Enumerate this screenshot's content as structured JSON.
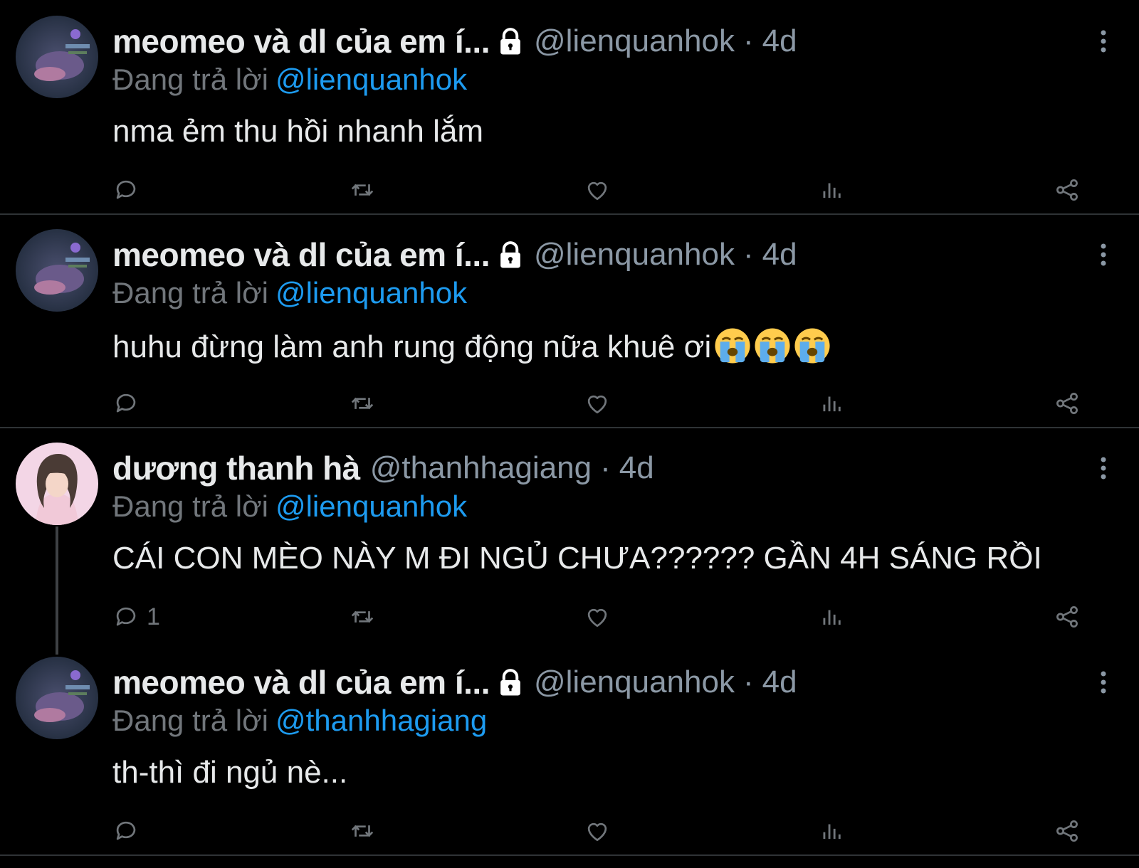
{
  "tweets": [
    {
      "name": "meomeo và dl của em í...",
      "locked": true,
      "handle": "@lienquanhok",
      "time": "4d",
      "reply_prefix": "Đang trả lời",
      "reply_to": "@lienquanhok",
      "text": "nma ẻm thu hồi nhanh lắm",
      "reply_count": ""
    },
    {
      "name": "meomeo và dl của em í...",
      "locked": true,
      "handle": "@lienquanhok",
      "time": "4d",
      "reply_prefix": "Đang trả lời",
      "reply_to": "@lienquanhok",
      "text": "huhu đừng làm anh rung động nữa khuê ơi",
      "emojis": [
        "loudly-crying-face",
        "loudly-crying-face",
        "loudly-crying-face"
      ],
      "reply_count": ""
    },
    {
      "name": "dương thanh hà",
      "locked": false,
      "handle": "@thanhhagiang",
      "time": "4d",
      "reply_prefix": "Đang trả lời",
      "reply_to": "@lienquanhok",
      "text": "CÁI CON MÈO NÀY M ĐI NGỦ CHƯA?????? GẦN 4H SÁNG RỒI",
      "reply_count": "1"
    },
    {
      "name": "meomeo và dl của em í...",
      "locked": true,
      "handle": "@lienquanhok",
      "time": "4d",
      "reply_prefix": "Đang trả lời",
      "reply_to": "@thanhhagiang",
      "text": "th-thì đi ngủ nè...",
      "reply_count": ""
    }
  ],
  "icons": {
    "reply": "reply-icon",
    "retweet": "retweet-icon",
    "like": "heart-icon",
    "views": "views-icon",
    "share": "share-icon",
    "more": "more-vertical-icon",
    "lock": "lock-icon"
  },
  "colors": {
    "background": "#000000",
    "name": "#e7e9ea",
    "handle": "#8b98a5",
    "muted": "#71767b",
    "link": "#1d9bf0",
    "separator": "#2f3336"
  }
}
